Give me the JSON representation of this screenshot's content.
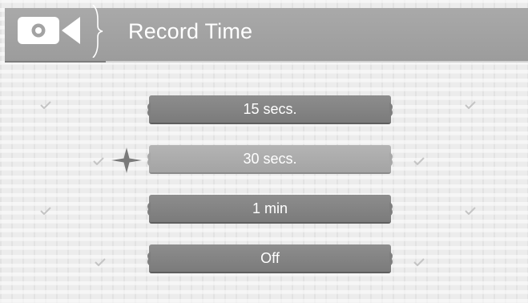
{
  "header": {
    "title": "Record Time",
    "icon": "video-camera-icon"
  },
  "options": [
    {
      "label": "15 secs.",
      "selected": false
    },
    {
      "label": "30 secs.",
      "selected": true
    },
    {
      "label": "1 min",
      "selected": false
    },
    {
      "label": "Off",
      "selected": false
    }
  ],
  "selection_marker": "star-icon",
  "colors": {
    "header": "#a3a3a3",
    "button": "#858585",
    "button_selected": "#ababab",
    "text": "#ffffff",
    "background": "#ececec"
  }
}
